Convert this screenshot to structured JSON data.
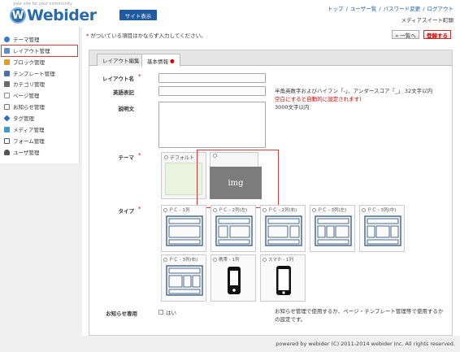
{
  "header": {
    "tagline": "your site for your community",
    "logo_text": "Webider",
    "logo_mark": "W",
    "site_button": "サイト表示",
    "links": [
      "トップ",
      "ユーザー覧",
      "パスワード変更",
      "ログアウト"
    ],
    "link_sep": "/",
    "user_name": "メディアスイート町頭"
  },
  "sidebar": {
    "items": [
      {
        "label": "テーマ管理",
        "icon": "globe-icon",
        "color": "#3a7bc8"
      },
      {
        "label": "レイアウト管理",
        "icon": "layout-icon",
        "color": "#5a8fd0"
      },
      {
        "label": "ブロック管理",
        "icon": "block-icon",
        "color": "#e0a020"
      },
      {
        "label": "テンプレート管理",
        "icon": "template-icon",
        "color": "#4a6fb0"
      },
      {
        "label": "カテゴリ管理",
        "icon": "category-icon",
        "color": "#6a6a6a"
      },
      {
        "label": "ページ管理",
        "icon": "page-icon",
        "color": "#888888"
      },
      {
        "label": "お知らせ管理",
        "icon": "news-icon",
        "color": "#777777"
      },
      {
        "label": "タグ管理",
        "icon": "tag-icon",
        "color": "#2a6fc0"
      },
      {
        "label": "メディア管理",
        "icon": "media-icon",
        "color": "#3a9fd0"
      },
      {
        "label": "フォーム管理",
        "icon": "form-icon",
        "color": "#555555"
      },
      {
        "label": "ユーザ管理",
        "icon": "user-icon",
        "color": "#555555"
      }
    ]
  },
  "main": {
    "required_note": "がついている項目はかならず入力してください。",
    "required_mark": "*",
    "back_button": "« 一覧へ",
    "register_button": "登録する",
    "tabs": [
      {
        "label": "レイアウト編集"
      },
      {
        "label": "基本情報"
      }
    ],
    "form": {
      "layout_name_label": "レイアウト名",
      "english_label": "英語表記",
      "english_hint": "半角英数字およびハイフン「-」、アンダースコア「_」 32文字以内",
      "english_hint_red": "空白にすると自動的に設定されます)",
      "description_label": "説明文",
      "description_hint": "3000文字以内",
      "theme_label": "テーマ",
      "theme_default": "デフォルト",
      "img_placeholder": "img",
      "type_label": "タイプ",
      "types": [
        "ＰＣ - 1列",
        "ＰＣ - 2列(左)",
        "ＰＣ - 2列(右)",
        "ＰＣ - 3列(左)",
        "ＰＣ - 3列(中)",
        "ＰＣ - 3列(右)",
        "携帯 - 1列",
        "スマホ - 1列"
      ],
      "news_label": "お知らせ専用",
      "news_checkbox": "はい",
      "news_hint": "お知らせ管理で使用するか、ページ・テンプレート管理等で使用するかの設定です。"
    }
  },
  "footer": {
    "text": "powered by webider (C) 2011-2014 webider Inc. All rights reserved."
  },
  "colors": {
    "brand": "#2b6aa8",
    "required": "#d40000",
    "highlight": "#d93b3b"
  }
}
